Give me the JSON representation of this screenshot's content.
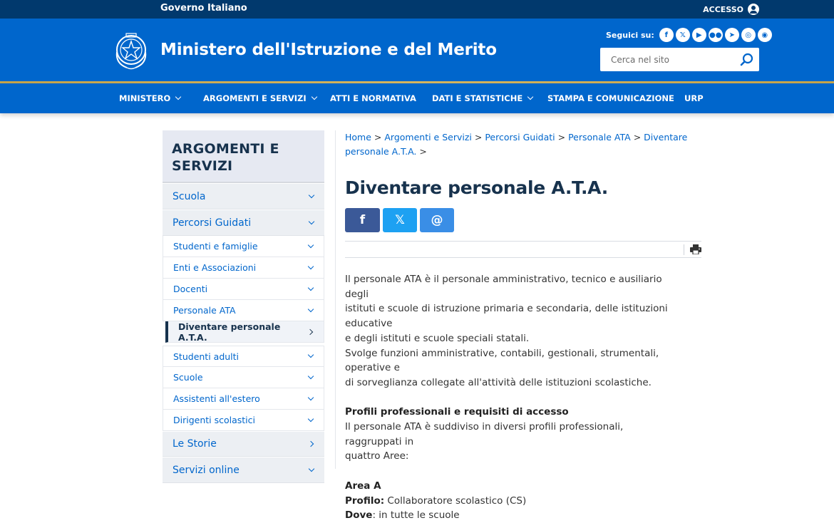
{
  "topbar": {
    "gov_label": "Governo Italiano",
    "access_label": "ACCESSO"
  },
  "header": {
    "title": "Ministero dell'Istruzione e del Merito",
    "follow_label": "Seguici su:",
    "social": [
      "f",
      "𝕏",
      "▶",
      "●●",
      "➤",
      "◎",
      "◉"
    ],
    "search_placeholder": "Cerca nel sito"
  },
  "nav": [
    {
      "label": "MINISTERO",
      "dropdown": true
    },
    {
      "label": "ARGOMENTI E SERVIZI",
      "dropdown": true
    },
    {
      "label": "ATTI E NORMATIVA",
      "dropdown": false
    },
    {
      "label": "DATI E STATISTICHE",
      "dropdown": true
    },
    {
      "label": "STAMPA E COMUNICAZIONE",
      "dropdown": false
    },
    {
      "label": "URP",
      "dropdown": false
    }
  ],
  "sidebar": {
    "title": "ARGOMENTI E SERVIZI",
    "items": [
      {
        "label": "Scuola",
        "level": 1,
        "icon": "chevron-down"
      },
      {
        "label": "Percorsi Guidati",
        "level": 1,
        "icon": "chevron-down"
      },
      {
        "label": "Studenti e famiglie",
        "level": 2,
        "icon": "chevron-down"
      },
      {
        "label": "Enti e Associazioni",
        "level": 2,
        "icon": "chevron-down"
      },
      {
        "label": "Docenti",
        "level": 2,
        "icon": "chevron-down"
      },
      {
        "label": "Personale ATA",
        "level": 2,
        "icon": "chevron-down"
      },
      {
        "label": "Diventare personale A.T.A.",
        "level": 3,
        "icon": "chevron-right",
        "active": true
      },
      {
        "label": "Studenti adulti",
        "level": 2,
        "icon": "chevron-down"
      },
      {
        "label": "Scuole",
        "level": 2,
        "icon": "chevron-down"
      },
      {
        "label": "Assistenti all'estero",
        "level": 2,
        "icon": "chevron-down"
      },
      {
        "label": "Dirigenti scolastici",
        "level": 2,
        "icon": "chevron-down"
      },
      {
        "label": "Le Storie",
        "level": 1,
        "icon": "chevron-right"
      },
      {
        "label": "Servizi online",
        "level": 1,
        "icon": "chevron-down"
      }
    ]
  },
  "breadcrumb": [
    "Home",
    "Argomenti e Servizi",
    "Percorsi Guidati",
    "Personale ATA",
    "Diventare personale A.T.A."
  ],
  "breadcrumb_sep": ">",
  "page_title": "Diventare personale A.T.A.",
  "share": {
    "facebook": "f",
    "twitter": "𝕏",
    "email": "@"
  },
  "content": {
    "p1_line1": "Il personale ATA è il personale amministrativo, tecnico e ausiliario degli",
    "p1_line2": "istituti e scuole di istruzione primaria e secondaria, delle istituzioni educative",
    "p1_line3": "e degli istituti e scuole speciali statali.",
    "p2_line1": "Svolge funzioni amministrative, contabili, gestionali, strumentali, operative e",
    "p2_line2": "di sorveglianza collegate all'attività delle istituzioni scolastiche.",
    "h_profili": "Profili professionali e requisiti di accesso",
    "p3_line1": "Il personale ATA è suddiviso in diversi profili professionali, raggruppati in",
    "p3_line2": "quattro Aree:",
    "area_title": "Area A",
    "profilo_label": "Profilo:",
    "profilo_value": " Collaboratore scolastico (CS)",
    "dove_label": "Dove",
    "dove_value": ": in tutte le scuole"
  },
  "colors": {
    "brand_blue": "#0066cc",
    "dark_blue": "#01396d",
    "title_dark": "#17324d",
    "gold": "#c9a64a"
  }
}
